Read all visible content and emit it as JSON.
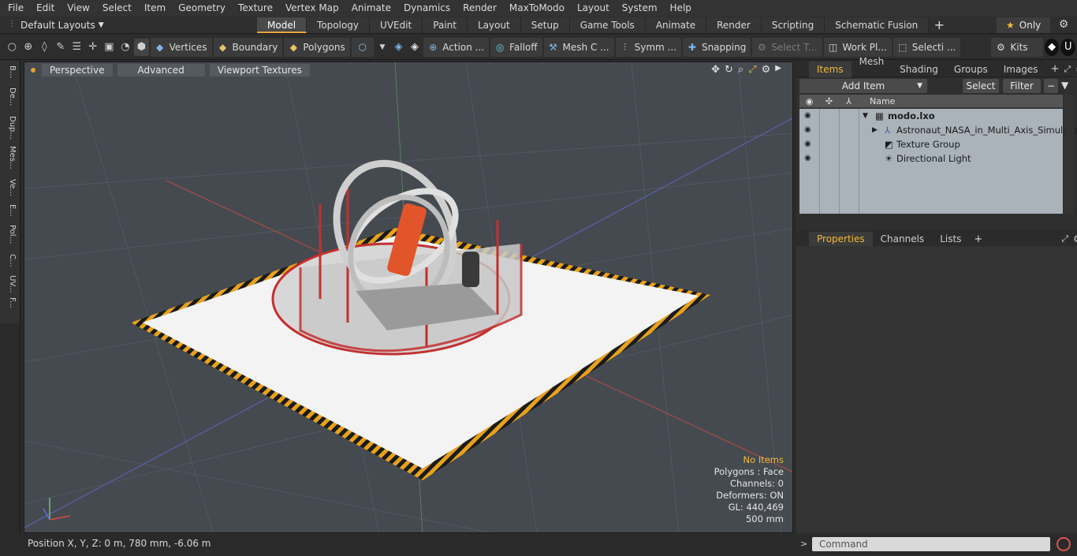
{
  "menu": [
    "File",
    "Edit",
    "View",
    "Select",
    "Item",
    "Geometry",
    "Texture",
    "Vertex Map",
    "Animate",
    "Dynamics",
    "Render",
    "MaxToModo",
    "Layout",
    "System",
    "Help"
  ],
  "layout_select": "Default Layouts",
  "tabs": [
    {
      "label": "Model",
      "active": true
    },
    {
      "label": "Topology"
    },
    {
      "label": "UVEdit"
    },
    {
      "label": "Paint"
    },
    {
      "label": "Layout"
    },
    {
      "label": "Setup"
    },
    {
      "label": "Game Tools"
    },
    {
      "label": "Animate"
    },
    {
      "label": "Render"
    },
    {
      "label": "Scripting"
    },
    {
      "label": "Schematic Fusion"
    }
  ],
  "only_label": "Only",
  "toolbar": {
    "vertices": "Vertices",
    "boundary": "Boundary",
    "polygons": "Polygons",
    "action": "Action ...",
    "falloff": "Falloff",
    "mesh": "Mesh C ...",
    "symm": "Symm ...",
    "snapping": "Snapping",
    "select_t": "Select T...",
    "work_pl": "Work Pl...",
    "selecti": "Selecti ...",
    "kits": "Kits"
  },
  "left_tabs": [
    "B...",
    "De...",
    "Dup...",
    "Mes...",
    "Ve...",
    "E...",
    "Pol...",
    "C...",
    "UV...",
    "F..."
  ],
  "viewport": {
    "tabs": [
      "Perspective",
      "Advanced",
      "Viewport Textures"
    ],
    "info": {
      "selection": "No Items",
      "polygons": "Polygons : Face",
      "channels": "Channels: 0",
      "deformers": "Deformers: ON",
      "gl": "GL: 440,469",
      "scale": "500 mm"
    }
  },
  "items_panel": {
    "tabs": [
      "Items",
      "Mesh ...",
      "Shading",
      "Groups",
      "Images"
    ],
    "add_item": "Add Item",
    "select": "Select",
    "filter": "Filter",
    "column_name": "Name",
    "rows": [
      {
        "label": "modo.lxo"
      },
      {
        "label": "Astronaut_NASA_in_Multi_Axis_Simulator"
      },
      {
        "label": "Texture Group"
      },
      {
        "label": "Directional Light"
      }
    ]
  },
  "properties_panel": {
    "tabs": [
      "Properties",
      "Channels",
      "Lists"
    ]
  },
  "status": {
    "position": "Position X, Y, Z:   0 m, 780 mm, -6.06 m"
  },
  "command": {
    "placeholder": "Command"
  },
  "colors": {
    "accent": "#f0b93a",
    "viewport_bg": "#454a50",
    "items_bg": "#aab2ba"
  }
}
